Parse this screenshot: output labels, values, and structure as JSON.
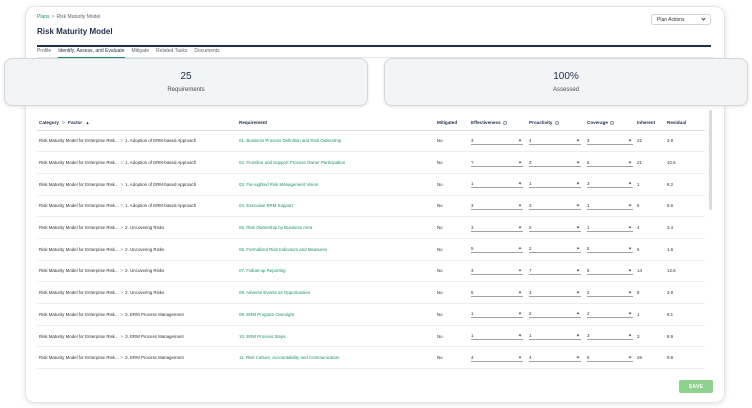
{
  "breadcrumb": {
    "root": "Plans",
    "separator": ">",
    "current": "Risk Maturity Model"
  },
  "page_title": "Risk Maturity Model",
  "plan_actions_label": "Plan Actions",
  "tabs": [
    {
      "label": "Profile"
    },
    {
      "label": "Identify, Assess, and Evaluate"
    },
    {
      "label": "Mitigate"
    },
    {
      "label": "Related Tasks"
    },
    {
      "label": "Documents"
    }
  ],
  "stats": {
    "requirements": {
      "value": "25",
      "label": "Requirements"
    },
    "assessed": {
      "value": "100%",
      "label": "Assessed"
    }
  },
  "table": {
    "headers": {
      "category": "Category",
      "factor": "Factor",
      "requirement": "Requirement",
      "mitigated": "Mitigated",
      "effectiveness": "Effectiveness",
      "proactivity": "Proactivity",
      "coverage": "Coverage",
      "inherent": "Inherent",
      "residual": "Residual"
    },
    "rows": [
      {
        "category": "Risk Maturity Model for Enterprise Risk...",
        "factor": "1. Adoption of ERM-based Approach",
        "requirement": "01. Business Process Definition and Risk Ownership",
        "mitigated": "No",
        "effectiveness": "3",
        "proactivity": "4",
        "coverage": "3",
        "inherent": "22",
        "residual": "3.9"
      },
      {
        "category": "Risk Maturity Model for Enterprise Risk...",
        "factor": "1. Adoption of ERM-based Approach",
        "requirement": "02. Frontline and Support Process Owner Participation",
        "mitigated": "No",
        "effectiveness": "?",
        "proactivity": "3",
        "coverage": "5",
        "inherent": "21",
        "residual": "10.5"
      },
      {
        "category": "Risk Maturity Model for Enterprise Risk...",
        "factor": "1. Adoption of ERM-based Approach",
        "requirement": "03. Far-sighted Risk Management Vision",
        "mitigated": "No",
        "effectiveness": "1",
        "proactivity": "1",
        "coverage": "3",
        "inherent": "1",
        "residual": "8.2"
      },
      {
        "category": "Risk Maturity Model for Enterprise Risk...",
        "factor": "1. Adoption of ERM-based Approach",
        "requirement": "04. Executive ERM Support",
        "mitigated": "No",
        "effectiveness": "3",
        "proactivity": "3",
        "coverage": "1",
        "inherent": "6",
        "residual": "5.6"
      },
      {
        "category": "Risk Maturity Model for Enterprise Risk...",
        "factor": "2. Uncovering Risks",
        "requirement": "05. Risk Ownership by Business Area",
        "mitigated": "No",
        "effectiveness": "3",
        "proactivity": "2",
        "coverage": "1",
        "inherent": "4",
        "residual": "3.4"
      },
      {
        "category": "Risk Maturity Model for Enterprise Risk...",
        "factor": "2. Uncovering Risks",
        "requirement": "06. Formalized Risk Indicators and Measures",
        "mitigated": "No",
        "effectiveness": "5",
        "proactivity": "2",
        "coverage": "5",
        "inherent": "6",
        "residual": "1.6"
      },
      {
        "category": "Risk Maturity Model for Enterprise Risk...",
        "factor": "2. Uncovering Risks",
        "requirement": "07. Follow-up Reporting",
        "mitigated": "No",
        "effectiveness": "3",
        "proactivity": "7",
        "coverage": "5",
        "inherent": "14",
        "residual": "12.6"
      },
      {
        "category": "Risk Maturity Model for Enterprise Risk...",
        "factor": "2. Uncovering Risks",
        "requirement": "08. Adverse Events as Opportunities",
        "mitigated": "No",
        "effectiveness": "5",
        "proactivity": "3",
        "coverage": "2",
        "inherent": "8",
        "residual": "3.9"
      },
      {
        "category": "Risk Maturity Model for Enterprise Risk...",
        "factor": "3. ERM Process Management",
        "requirement": "09. ERM Program Oversight",
        "mitigated": "No",
        "effectiveness": "1",
        "proactivity": "2",
        "coverage": "2",
        "inherent": "1",
        "residual": "8.1"
      },
      {
        "category": "Risk Maturity Model for Enterprise Risk...",
        "factor": "3. ERM Process Management",
        "requirement": "10. ERM Process Steps",
        "mitigated": "No",
        "effectiveness": "1",
        "proactivity": "1",
        "coverage": "3",
        "inherent": "3",
        "residual": "8.9"
      },
      {
        "category": "Risk Maturity Model for Enterprise Risk...",
        "factor": "3. ERM Process Management",
        "requirement": "11. Risk Culture, Accountability and Communication",
        "mitigated": "No",
        "effectiveness": "4",
        "proactivity": "4",
        "coverage": "6",
        "inherent": "26",
        "residual": "9.9"
      }
    ]
  },
  "save_label": "SAVE",
  "colors": {
    "accent": "#1b8d70",
    "title": "#1f2d4d",
    "save": "#8fd18f"
  }
}
